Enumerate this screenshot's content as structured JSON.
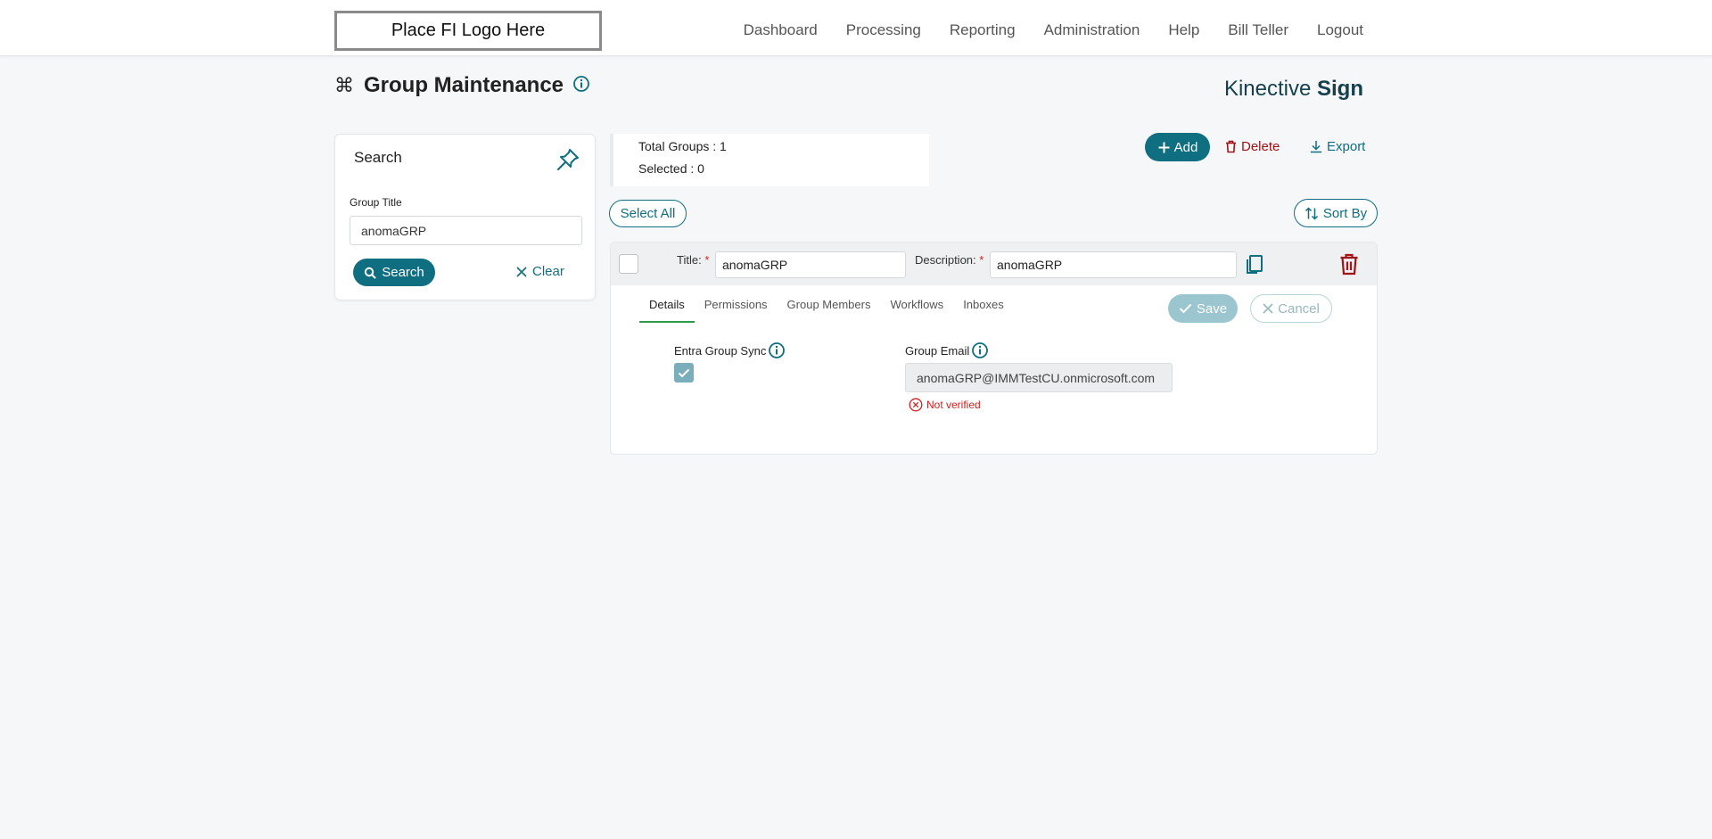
{
  "header": {
    "logo_text": "Place FI Logo Here",
    "nav": [
      "Dashboard",
      "Processing",
      "Reporting",
      "Administration",
      "Help",
      "Bill Teller",
      "Logout"
    ]
  },
  "page": {
    "title": "Group Maintenance",
    "brand_light": "Kinective ",
    "brand_bold": "Sign"
  },
  "search": {
    "heading": "Search",
    "group_title_label": "Group Title",
    "group_title_value": "anomaGRP",
    "search_button": "Search",
    "clear_button": "Clear"
  },
  "totals": {
    "total_groups": "Total Groups : 1",
    "selected": "Selected : 0"
  },
  "actions": {
    "add": "Add",
    "delete": "Delete",
    "export": "Export",
    "select_all": "Select All",
    "sort_by": "Sort By"
  },
  "group": {
    "title_label": "Title:",
    "title_value": "anomaGRP",
    "description_label": "Description:",
    "description_value": "anomaGRP",
    "required_mark": "*",
    "tabs": [
      "Details",
      "Permissions",
      "Group Members",
      "Workflows",
      "Inboxes"
    ],
    "save": "Save",
    "cancel": "Cancel",
    "entra_sync_label": "Entra Group Sync",
    "entra_sync_checked": true,
    "group_email_label": "Group Email",
    "group_email_value": "anomaGRP@IMMTestCU.onmicrosoft.com",
    "verify_status": "Not verified"
  },
  "colors": {
    "accent": "#0f6e80",
    "danger": "#a01418",
    "tab_active_underline": "#2f9a4a",
    "error_text": "#d31f1f"
  }
}
